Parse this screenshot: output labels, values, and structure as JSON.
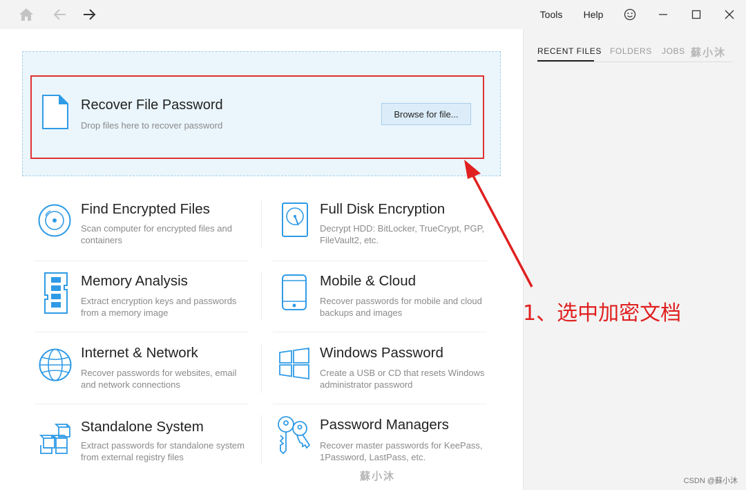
{
  "titlebar": {
    "home_icon": "home-icon",
    "back_icon": "arrow-left-icon",
    "forward_icon": "arrow-right-icon",
    "tools_label": "Tools",
    "help_label": "Help",
    "feedback_icon": "smiley-icon",
    "minimize_icon": "minimize-icon",
    "maximize_icon": "maximize-icon",
    "close_icon": "close-icon"
  },
  "sidebar": {
    "tabs": [
      {
        "label": "RECENT FILES",
        "active": true
      },
      {
        "label": "FOLDERS",
        "active": false
      },
      {
        "label": "JOBS",
        "active": false
      }
    ]
  },
  "recover": {
    "title": "Recover File Password",
    "subtitle": "Drop files here to recover password",
    "browse_label": "Browse for file..."
  },
  "cards": [
    {
      "title": "Find Encrypted Files",
      "desc": "Scan computer for encrypted files and containers",
      "icon": "disc-search-icon"
    },
    {
      "title": "Full Disk Encryption",
      "desc": "Decrypt HDD: BitLocker, TrueCrypt, PGP, FileVault2, etc.",
      "icon": "hard-disk-icon"
    },
    {
      "title": "Memory Analysis",
      "desc": "Extract encryption keys and passwords from a memory image",
      "icon": "memory-chip-icon"
    },
    {
      "title": "Mobile & Cloud",
      "desc": "Recover passwords for mobile and cloud backups and images",
      "icon": "mobile-phone-icon"
    },
    {
      "title": "Internet & Network",
      "desc": "Recover passwords for websites, email and network connections",
      "icon": "globe-icon"
    },
    {
      "title": "Windows Password",
      "desc": "Create a USB or CD that resets Windows administrator password",
      "icon": "windows-logo-icon"
    },
    {
      "title": "Standalone System",
      "desc": "Extract passwords for standalone system from external registry files",
      "icon": "cubes-icon"
    },
    {
      "title": "Password Managers",
      "desc": "Recover master passwords for KeePass, 1Password, LastPass, etc.",
      "icon": "keys-icon"
    }
  ],
  "annotation": {
    "text": "1、选中加密文档",
    "color": "#e02020"
  },
  "watermarks": {
    "top": "蘇小沐",
    "bottom": "蘇小沐",
    "footer": "CSDN @蘇小沐"
  },
  "colors": {
    "accent": "#2f9be6",
    "dropzone": "#eaf5fc",
    "highlight": "#e03030"
  }
}
